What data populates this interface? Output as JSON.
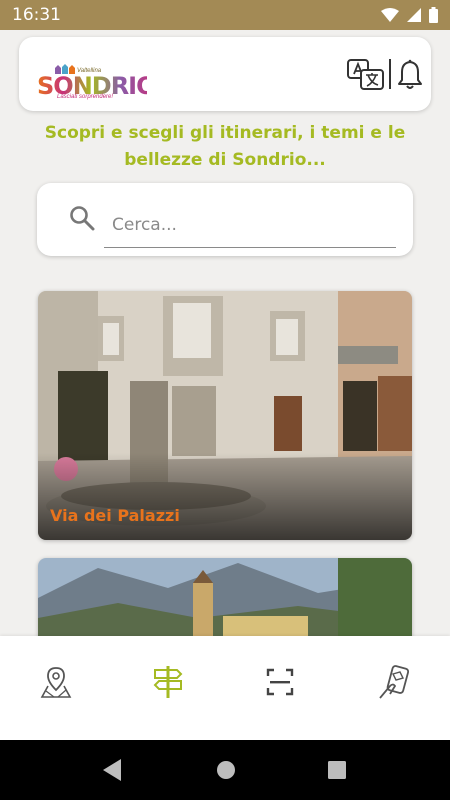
{
  "status_bar": {
    "time": "16:31"
  },
  "header": {
    "logo": {
      "subtitle": "Valtellina",
      "name": "SONDRIO",
      "tagline": "Lasciati sorprendere!"
    },
    "translate_icon": "translate-icon",
    "bell_icon": "bell-icon"
  },
  "headline": "Scopri e scegli gli itinerari, i temi e le bellezze di Sondrio...",
  "search": {
    "placeholder": "Cerca..."
  },
  "cards": [
    {
      "title": "Via dei Palazzi"
    },
    {
      "title": ""
    }
  ],
  "bottom_nav": {
    "items": [
      {
        "icon": "map-pin-icon",
        "active": false
      },
      {
        "icon": "signpost-icon",
        "active": true
      },
      {
        "icon": "scan-frame-icon",
        "active": false
      },
      {
        "icon": "ar-phone-icon",
        "active": false
      }
    ]
  },
  "colors": {
    "status_bar": "#a38a55",
    "accent_green": "#a5ba22",
    "card_title": "#e8731c",
    "background": "#f1f0ee"
  }
}
